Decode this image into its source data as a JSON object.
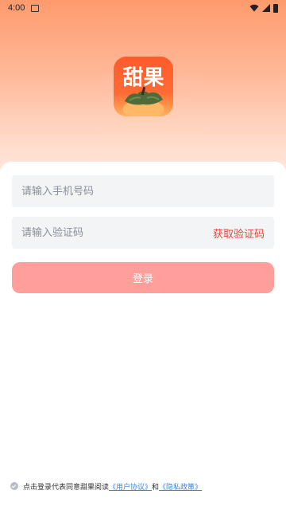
{
  "status_bar": {
    "time": "4:00"
  },
  "logo": {
    "text": "甜果"
  },
  "form": {
    "phone_placeholder": "请输入手机号码",
    "code_placeholder": "请输入验证码",
    "get_code_label": "获取验证码",
    "login_label": "登录"
  },
  "agreement": {
    "prefix": "点击登录代表同意甜果阅读",
    "user_agreement": "《用户协议》",
    "and": "和",
    "privacy_policy": "《隐私政策》"
  },
  "colors": {
    "accent_red": "#e8443a",
    "login_button": "#ff9e9b",
    "link": "#3a86e6",
    "hero_top": "#fe9a6c"
  }
}
